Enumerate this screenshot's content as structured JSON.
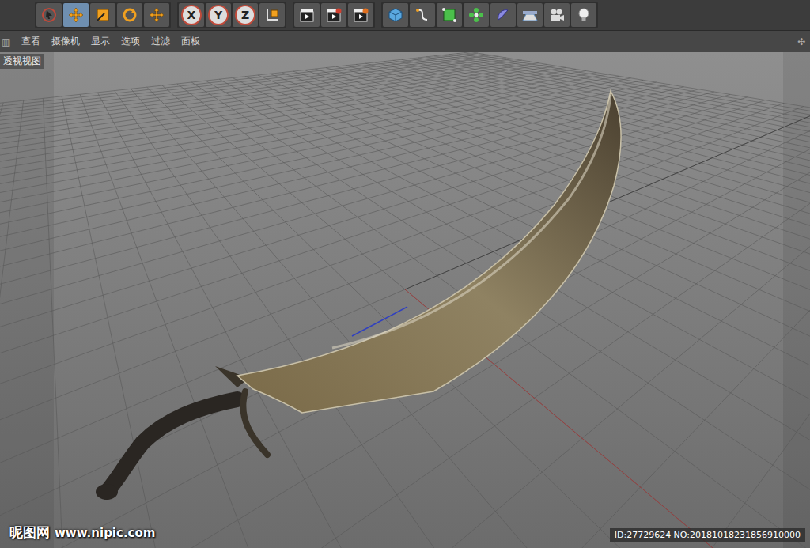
{
  "window": {
    "title": "透视视图"
  },
  "toolbar": {
    "groups": [
      {
        "items": [
          {
            "kind": "select",
            "selected": false
          },
          {
            "kind": "move",
            "selected": true
          },
          {
            "kind": "scale",
            "selected": false
          },
          {
            "kind": "rotate",
            "selected": false
          },
          {
            "kind": "transform",
            "selected": false
          }
        ]
      },
      {
        "items": [
          {
            "kind": "axis",
            "label": "X"
          },
          {
            "kind": "axis",
            "label": "Y"
          },
          {
            "kind": "axis",
            "label": "Z"
          },
          {
            "kind": "coord"
          }
        ]
      },
      {
        "items": [
          {
            "kind": "render"
          },
          {
            "kind": "render-view"
          },
          {
            "kind": "render-settings"
          }
        ]
      },
      {
        "items": [
          {
            "kind": "cube"
          },
          {
            "kind": "spline"
          },
          {
            "kind": "nurbs"
          },
          {
            "kind": "array"
          },
          {
            "kind": "deformer"
          },
          {
            "kind": "floor"
          },
          {
            "kind": "camera"
          },
          {
            "kind": "light"
          }
        ]
      }
    ]
  },
  "menu": {
    "grip": "▥",
    "items": [
      "查看",
      "摄像机",
      "显示",
      "选项",
      "过滤",
      "面板"
    ],
    "corner": "✣"
  },
  "watermark": {
    "logo": "昵图网",
    "url": "www.nipic.com",
    "id": "ID:27729624 NO:20181018231856910000"
  }
}
